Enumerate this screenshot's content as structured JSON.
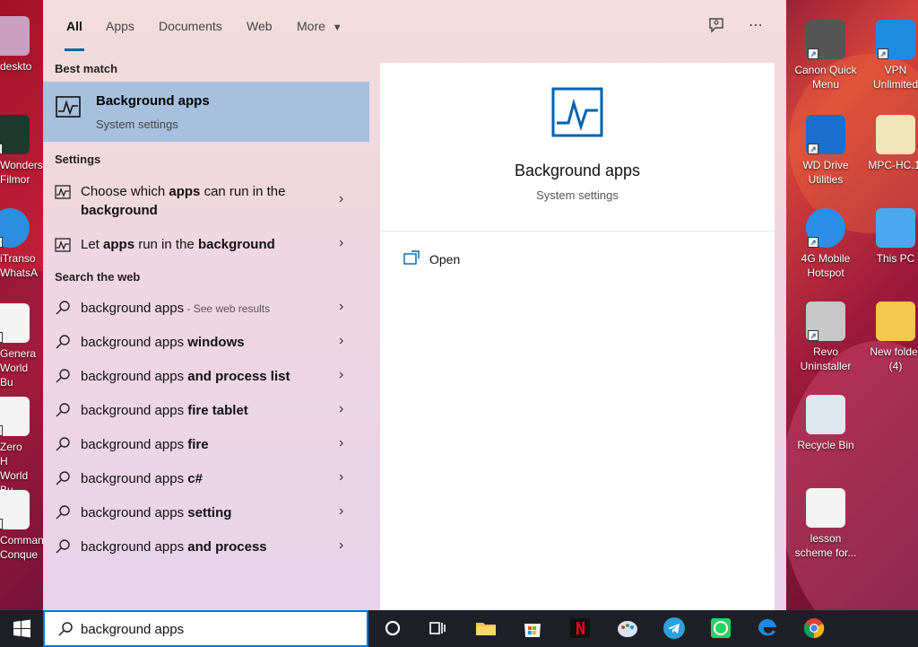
{
  "tabs": [
    {
      "label": "All",
      "active": true
    },
    {
      "label": "Apps"
    },
    {
      "label": "Documents"
    },
    {
      "label": "Web"
    },
    {
      "label": "More"
    }
  ],
  "sections": {
    "best_match": "Best match",
    "settings": "Settings",
    "search_web": "Search the web"
  },
  "best_match": {
    "title": "Background apps",
    "subtitle": "System settings"
  },
  "settings_results": [
    {
      "pre": "Choose which ",
      "b1": "apps",
      "mid": " can run in the ",
      "b2": "background"
    },
    {
      "pre": "Let ",
      "b1": "apps",
      "mid": " run in the ",
      "b2": "background"
    }
  ],
  "web_results": [
    {
      "base": "background apps",
      "suffix": "",
      "hint": " - See web results"
    },
    {
      "base": "background apps",
      "suffix": " windows"
    },
    {
      "base": "background apps",
      "suffix": " and process list"
    },
    {
      "base": "background apps",
      "suffix": " fire tablet"
    },
    {
      "base": "background apps",
      "suffix": " fire"
    },
    {
      "base": "background apps",
      "suffix": " c#"
    },
    {
      "base": "background apps",
      "suffix": " setting"
    },
    {
      "base": "background apps",
      "suffix": " and process"
    }
  ],
  "preview": {
    "title": "Background apps",
    "subtitle": "System settings",
    "open_label": "Open"
  },
  "search": {
    "query": "background apps"
  },
  "desktop_icons_left": [
    {
      "label": "deskto"
    },
    {
      "label": "Wonders Filmor"
    },
    {
      "label": "iTranso WhatsA"
    },
    {
      "label": "Genera World Bu"
    },
    {
      "label": "Zero H World Bu"
    },
    {
      "label": "Comman Conque"
    }
  ],
  "desktop_icons_right": [
    {
      "label": "Canon Quick Menu"
    },
    {
      "label": "VPN Unlimited"
    },
    {
      "label": "WD Drive Utilities"
    },
    {
      "label": "MPC-HC.1."
    },
    {
      "label": "4G Mobile Hotspot"
    },
    {
      "label": "This PC"
    },
    {
      "label": "Revo Uninstaller"
    },
    {
      "label": "New folder (4)"
    },
    {
      "label": "Recycle Bin"
    },
    {
      "label": "lesson scheme for..."
    }
  ],
  "colors": {
    "accent": "#0063b1",
    "selection": "#a6c0dd",
    "taskbar": "#1f1f28"
  }
}
